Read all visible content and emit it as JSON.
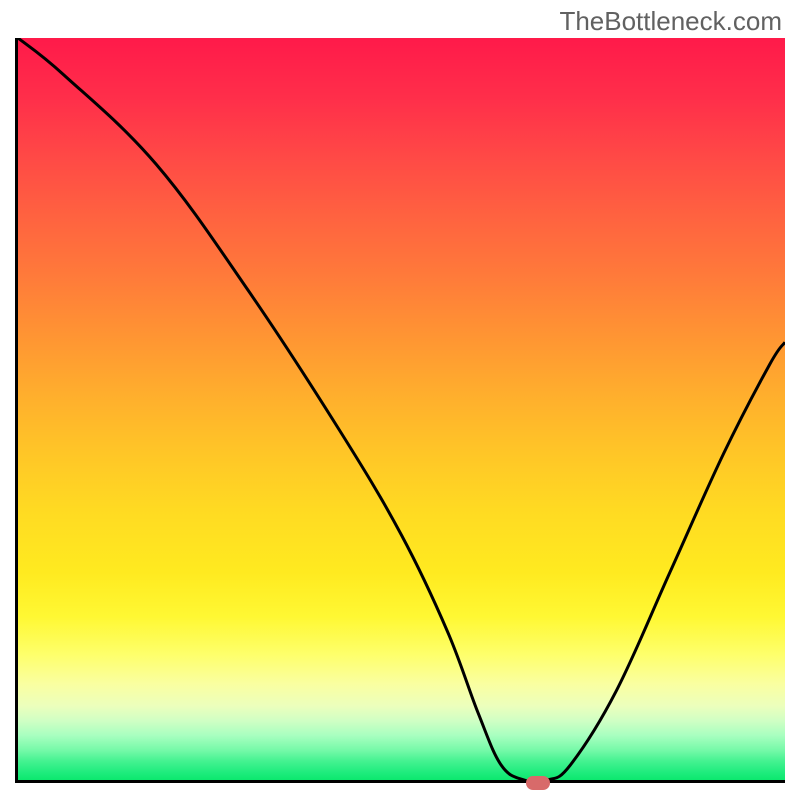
{
  "watermark": "TheBottleneck.com",
  "chart_data": {
    "type": "line",
    "title": "",
    "xlabel": "",
    "ylabel": "",
    "xlim": [
      0,
      100
    ],
    "ylim": [
      0,
      100
    ],
    "gradient_stops": [
      {
        "pos": 0,
        "color": "#ff1a4a"
      },
      {
        "pos": 50,
        "color": "#ffc020"
      },
      {
        "pos": 85,
        "color": "#feff80"
      },
      {
        "pos": 100,
        "color": "#0ce86e"
      }
    ],
    "series": [
      {
        "name": "bottleneck-curve",
        "x": [
          0,
          6,
          18,
          30,
          42,
          50,
          56,
          60,
          63,
          66,
          69,
          72,
          78,
          85,
          92,
          98,
          100
        ],
        "values": [
          100,
          95,
          83,
          66,
          47,
          33,
          20,
          9,
          2,
          0,
          0,
          2,
          12,
          28,
          44,
          56,
          59
        ]
      }
    ],
    "marker": {
      "x": 67.5,
      "y": 0,
      "color": "#d86a6a"
    },
    "annotations": []
  }
}
